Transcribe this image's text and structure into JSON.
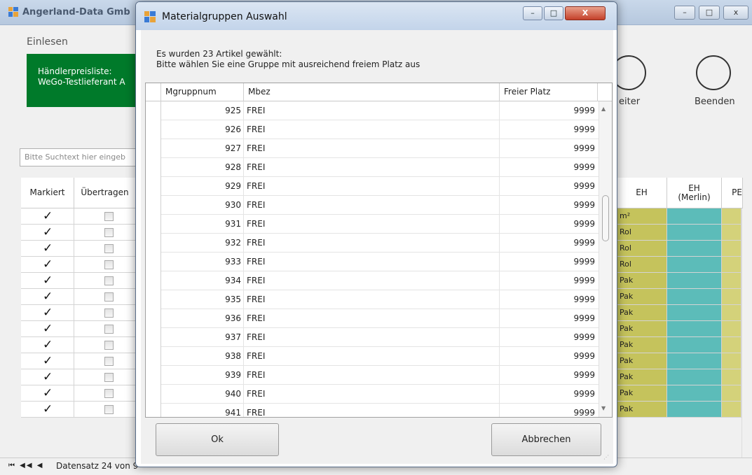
{
  "main_window": {
    "title": "Angerland-Data Gmb",
    "controls": [
      "–",
      "□",
      "x"
    ]
  },
  "toolbar": {
    "einlesen_label": "Einlesen",
    "haendler_tile": {
      "line1": "Händlerpreisliste:",
      "line2": "WeGo-Testlieferant A",
      "color": "#007a2a"
    },
    "weiter_label": "eiter",
    "beenden_label": "Beenden"
  },
  "search": {
    "placeholder": "Bitte Suchtext hier eingeb"
  },
  "bg_grid": {
    "headers": {
      "markiert": "Markiert",
      "uebertragen": "Übertragen",
      "eh": "EH",
      "eh_merlin_line1": "EH",
      "eh_merlin_line2": "(Merlin)",
      "pe": "PE"
    },
    "eh_values": [
      "m²",
      "Rol",
      "Rol",
      "Rol",
      "Pak",
      "Pak",
      "Pak",
      "Pak",
      "Pak",
      "Pak",
      "Pak",
      "Pak",
      "Pak"
    ],
    "checkbox_marked_glyph": "✓",
    "colors": {
      "eh": "#c5c35c",
      "merlin": "#5cbcb9",
      "pe": "#d4d27a"
    }
  },
  "footer": {
    "nav": "⏮ ◀◀ ◀",
    "record_text": "Datensatz 24 von 9"
  },
  "dialog": {
    "title": "Materialgruppen Auswahl",
    "controls": {
      "minimize": "–",
      "maximize": "□",
      "close": "X"
    },
    "message_line1": "Es wurden 23 Artikel gewählt:",
    "message_line2": "Bitte wählen Sie eine Gruppe mit ausreichend freiem Platz aus",
    "columns": {
      "num": "Mgruppnum",
      "bez": "Mbez",
      "frei": "Freier Platz"
    },
    "rows": [
      {
        "num": "925",
        "bez": "FREI",
        "frei": "9999"
      },
      {
        "num": "926",
        "bez": "FREI",
        "frei": "9999"
      },
      {
        "num": "927",
        "bez": "FREI",
        "frei": "9999"
      },
      {
        "num": "928",
        "bez": "FREI",
        "frei": "9999"
      },
      {
        "num": "929",
        "bez": "FREI",
        "frei": "9999"
      },
      {
        "num": "930",
        "bez": "FREI",
        "frei": "9999"
      },
      {
        "num": "931",
        "bez": "FREI",
        "frei": "9999"
      },
      {
        "num": "932",
        "bez": "FREI",
        "frei": "9999"
      },
      {
        "num": "933",
        "bez": "FREI",
        "frei": "9999"
      },
      {
        "num": "934",
        "bez": "FREI",
        "frei": "9999"
      },
      {
        "num": "935",
        "bez": "FREI",
        "frei": "9999"
      },
      {
        "num": "936",
        "bez": "FREI",
        "frei": "9999"
      },
      {
        "num": "937",
        "bez": "FREI",
        "frei": "9999"
      },
      {
        "num": "938",
        "bez": "FREI",
        "frei": "9999"
      },
      {
        "num": "939",
        "bez": "FREI",
        "frei": "9999"
      },
      {
        "num": "940",
        "bez": "FREI",
        "frei": "9999"
      },
      {
        "num": "941",
        "bez": "FREI",
        "frei": "9999"
      }
    ],
    "scroll_position": 0.33,
    "ok_label": "Ok",
    "cancel_label": "Abbrechen"
  }
}
